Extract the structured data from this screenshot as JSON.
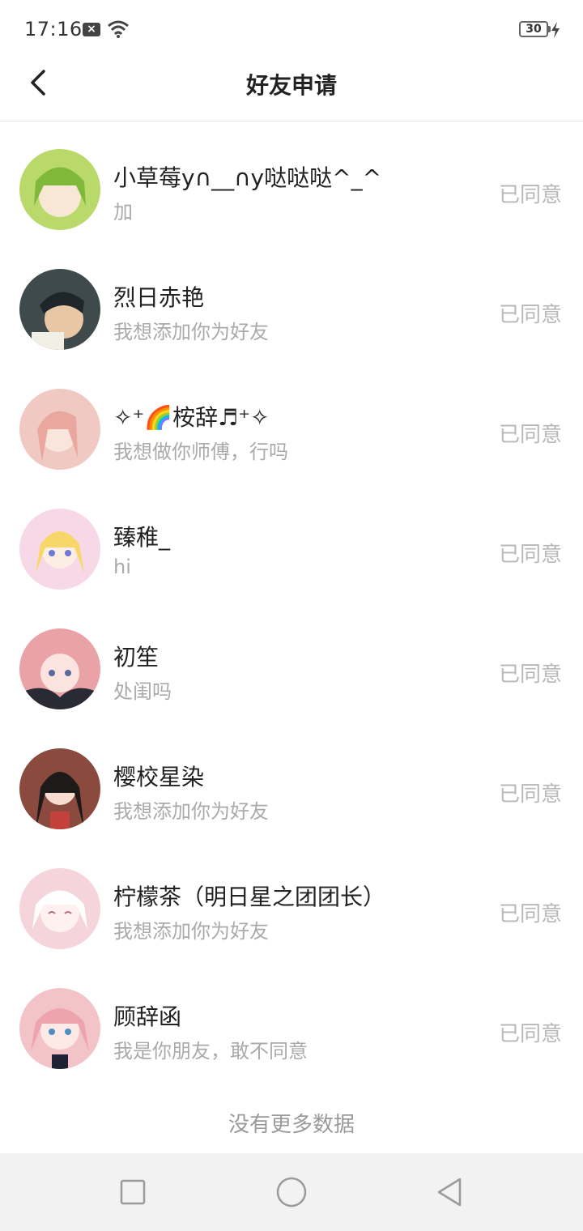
{
  "status_bar": {
    "time": "17:16",
    "battery": "30"
  },
  "header": {
    "title": "好友申请"
  },
  "requests": [
    {
      "name": "小草莓y∩__∩y哒哒哒^_^",
      "message": "加",
      "status": "已同意",
      "avatar_color": "#b9d96a"
    },
    {
      "name": "烈日赤艳",
      "message": "我想添加你为好友",
      "status": "已同意",
      "avatar_color": "#3f4a4d"
    },
    {
      "name": "✧⁺🌈桉辞♬⁺✧",
      "message": "我想做你师傅，行吗",
      "status": "已同意",
      "avatar_color": "#f0c9c2"
    },
    {
      "name": "臻稚_",
      "message": "hi",
      "status": "已同意",
      "avatar_color": "#f7d8e6"
    },
    {
      "name": "初笙",
      "message": "处闺吗",
      "status": "已同意",
      "avatar_color": "#e9a2a6"
    },
    {
      "name": "樱校星染",
      "message": "我想添加你为好友",
      "status": "已同意",
      "avatar_color": "#8a4a3e"
    },
    {
      "name": "柠檬茶（明日星之团团长）",
      "message": "我想添加你为好友",
      "status": "已同意",
      "avatar_color": "#f5d4dc"
    },
    {
      "name": "顾辞函",
      "message": "我是你朋友，敢不同意",
      "status": "已同意",
      "avatar_color": "#f2c4c8"
    }
  ],
  "footer": {
    "no_more": "没有更多数据"
  }
}
